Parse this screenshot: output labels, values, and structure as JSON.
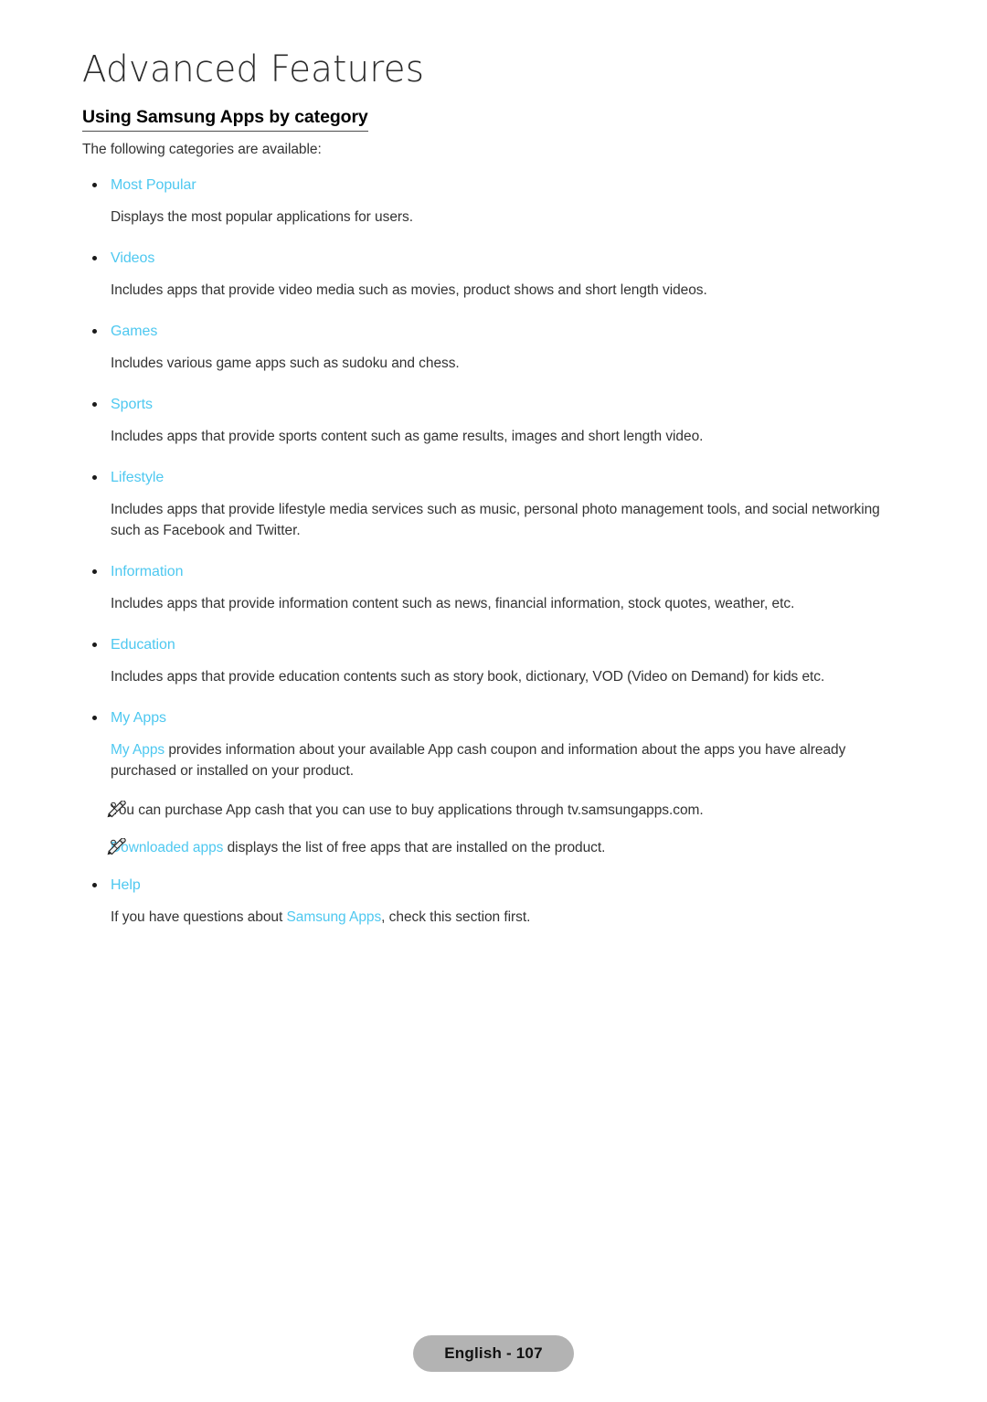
{
  "page": {
    "chapter_title": "Advanced Features",
    "section_heading": "Using Samsung Apps by category",
    "lead_line": "The following categories are available:",
    "accent_color": "#4ec8f0",
    "body_color": "#333333"
  },
  "categories": [
    {
      "term": "Most Popular",
      "description": "Displays the most popular applications for users."
    },
    {
      "term": "Videos",
      "description": "Includes apps that provide video media such as movies, product shows and short length videos."
    },
    {
      "term": "Games",
      "description": "Includes various game apps such as sudoku and chess."
    },
    {
      "term": "Sports",
      "description": "Includes apps that provide sports content such as game results, images and short length video."
    },
    {
      "term": "Lifestyle",
      "description": "Includes apps that provide lifestyle media services such as music, personal photo management tools, and social networking such as Facebook and Twitter."
    },
    {
      "term": "Information",
      "description": "Includes apps that provide information content such as news, financial information, stock quotes, weather, etc."
    },
    {
      "term": "Education",
      "description": "Includes apps that provide education contents such as story book, dictionary, VOD (Video on Demand) for kids etc."
    }
  ],
  "my_apps": {
    "term": "My Apps",
    "paragraph_accent": "My Apps",
    "paragraph_rest": " provides information about your available App cash coupon and information about the apps you have already purchased or installed on your product.",
    "notes": [
      {
        "icon": "pencil-note-icon",
        "accent": "",
        "text": "You can purchase App cash that you can use to buy applications through tv.samsungapps.com."
      },
      {
        "icon": "pencil-note-icon",
        "accent": "Downloaded apps",
        "text": " displays the list of free apps that are installed on the product."
      }
    ]
  },
  "help": {
    "term": "Help",
    "text_before": "If you have questions about ",
    "accent": "Samsung Apps",
    "text_after": ", check this section first."
  },
  "footer": {
    "label": "English - 107"
  }
}
